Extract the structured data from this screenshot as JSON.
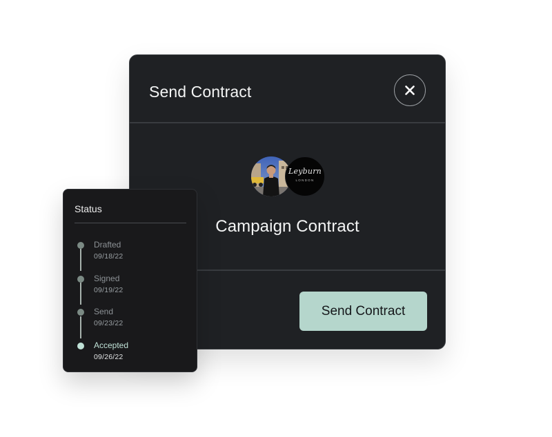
{
  "dialog": {
    "title": "Send Contract",
    "close_icon": "close-icon",
    "contract_name": "Campaign Contract",
    "send_button_label": "Send Contract",
    "avatars": [
      {
        "type": "person-photo"
      },
      {
        "type": "brand-logo",
        "brand_name": "Leyburn",
        "brand_sub": "LONDON"
      }
    ]
  },
  "status": {
    "title": "Status",
    "steps": [
      {
        "label": "Drafted",
        "date": "09/18/22",
        "active": false
      },
      {
        "label": "Signed",
        "date": "09/19/22",
        "active": false
      },
      {
        "label": "Send",
        "date": "09/23/22",
        "active": false
      },
      {
        "label": "Accepted",
        "date": "09/26/22",
        "active": true
      }
    ]
  },
  "colors": {
    "dialog_background": "#1f2124",
    "status_background": "#19191b",
    "accent": "#b5d6cc",
    "active_step": "#bfe1d6",
    "inactive_step": "#7b8a84",
    "text_primary": "#f3f4f4"
  }
}
